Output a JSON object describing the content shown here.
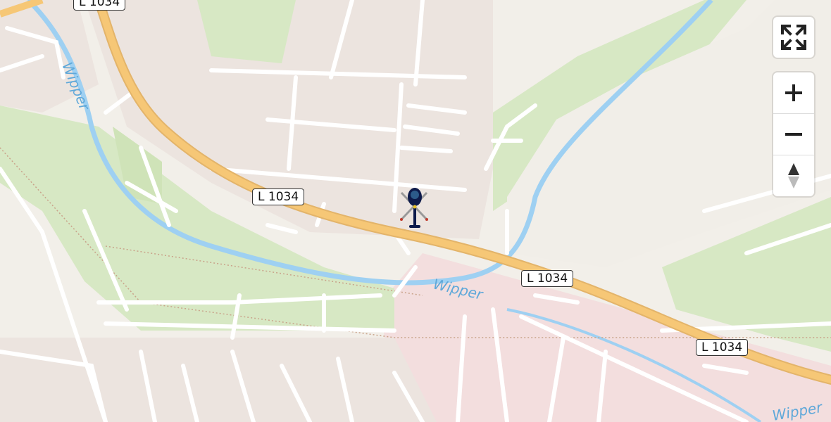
{
  "map": {
    "road_labels": [
      "L 1034",
      "L 1034",
      "L 1034",
      "L 1034",
      "L 1034"
    ],
    "river_labels": [
      "Wipper",
      "Wipper",
      "Wipper"
    ],
    "colors": {
      "background": "#f2efe9",
      "residential": "#ece4df",
      "green": "#d7e8c4",
      "river": "#9ed0f2",
      "road_major": "#f6c776",
      "road_minor": "#ffffff"
    }
  },
  "controls": {
    "fullscreen_icon": "fullscreen-icon",
    "zoom_in_icon": "plus-icon",
    "zoom_out_icon": "minus-icon",
    "compass_icon": "compass-icon"
  },
  "marker": {
    "icon": "helicopter-icon"
  }
}
